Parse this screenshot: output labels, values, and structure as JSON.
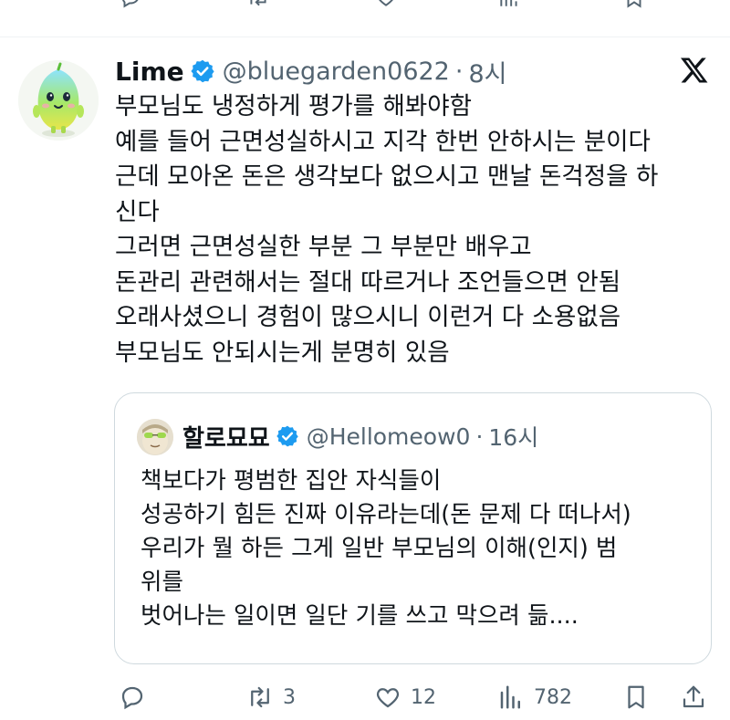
{
  "tweet": {
    "author_name": "Lime",
    "handle": "@bluegarden0622",
    "separator": "·",
    "time": "8시",
    "lines": [
      "부모님도 냉정하게 평가를 해봐야함",
      "예를 들어 근면성실하시고 지각 한번 안하시는 분이다",
      "근데 모아온 돈은 생각보다 없으시고 맨날 돈걱정을 하",
      "신다",
      "그러면 근면성실한 부분 그 부분만 배우고",
      "돈관리 관련해서는 절대 따르거나 조언들으면 안됨",
      "오래사셨으니 경험이 많으시니 이런거 다 소용없음",
      "부모님도 안되시는게 분명히 있음"
    ]
  },
  "quoted": {
    "author_name": "할로묘묘",
    "handle": "@Hellomeow0",
    "separator": "·",
    "time": "16시",
    "lines": [
      "책보다가 평범한 집안 자식들이",
      "성공하기 힘든 진짜 이유라는데(돈 문제 다 떠나서)",
      "우리가 뭘 하든 그게 일반 부모님의 이해(인지) 범",
      "위를",
      "벗어나는 일이면 일단 기를 쓰고 막으려 듦...."
    ]
  },
  "actions": {
    "reply_icon": "reply-icon",
    "retweet_icon": "retweet-icon",
    "retweet_count": "3",
    "like_icon": "heart-icon",
    "like_count": "12",
    "views_icon": "views-icon",
    "views_count": "782",
    "bookmark_icon": "bookmark-icon",
    "share_icon": "share-icon"
  },
  "colors": {
    "verified_blue": "#1d9bf0",
    "muted_text": "#536471",
    "border": "#cfd9de"
  }
}
